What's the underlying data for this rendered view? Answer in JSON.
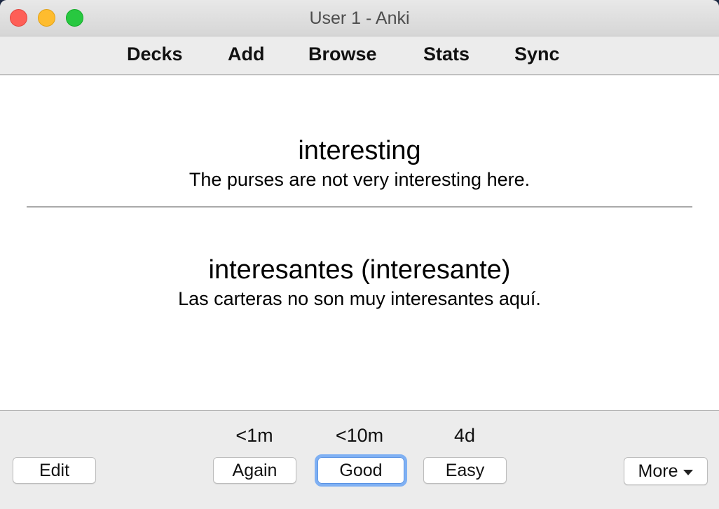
{
  "window": {
    "title": "User 1 - Anki"
  },
  "toolbar": {
    "decks": "Decks",
    "add": "Add",
    "browse": "Browse",
    "stats": "Stats",
    "sync": "Sync"
  },
  "card": {
    "front_word": "interesting",
    "front_sentence": "The purses are not very interesting here.",
    "back_word": "interesantes (interesante)",
    "back_sentence": "Las carteras no son muy interesantes aquí."
  },
  "answer_bar": {
    "edit_label": "Edit",
    "again_time": "<1m",
    "again_label": "Again",
    "good_time": "<10m",
    "good_label": "Good",
    "easy_time": "4d",
    "easy_label": "Easy",
    "more_label": "More"
  },
  "colors": {
    "close": "#fe5f57",
    "minimize": "#febc2e",
    "maximize": "#28c840",
    "focus_ring": "#7fb0f3"
  }
}
